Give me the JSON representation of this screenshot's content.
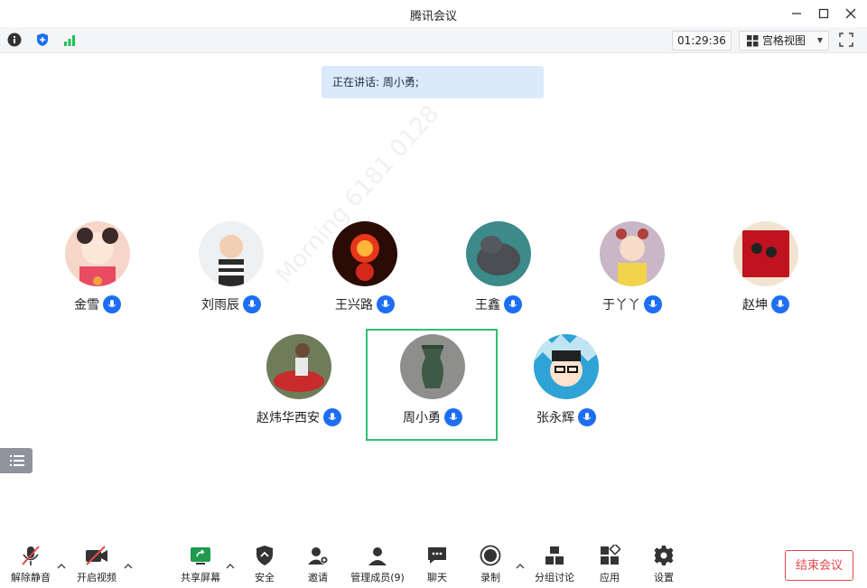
{
  "window": {
    "title": "腾讯会议"
  },
  "topbar": {
    "timer": "01:29:36",
    "view_label": "宫格视图"
  },
  "speaking": {
    "text": "正在讲话: 周小勇;"
  },
  "watermark": "Morning 6181 0128",
  "participants": [
    {
      "name": "金雪"
    },
    {
      "name": "刘雨辰"
    },
    {
      "name": "王兴路"
    },
    {
      "name": "王鑫"
    },
    {
      "name": "于丫丫"
    },
    {
      "name": "赵坤"
    },
    {
      "name": "赵炜华西安"
    },
    {
      "name": "周小勇"
    },
    {
      "name": "张永辉"
    }
  ],
  "bottom": {
    "unmute": "解除静音",
    "video": "开启视频",
    "share": "共享屏幕",
    "security": "安全",
    "invite": "邀请",
    "members": "管理成员(9)",
    "chat": "聊天",
    "record": "录制",
    "breakout": "分组讨论",
    "apps": "应用",
    "settings": "设置",
    "end": "结束会议"
  },
  "colors": {
    "accent": "#1d6ef2",
    "active_border": "#2fbf71",
    "end": "#e0484e"
  }
}
